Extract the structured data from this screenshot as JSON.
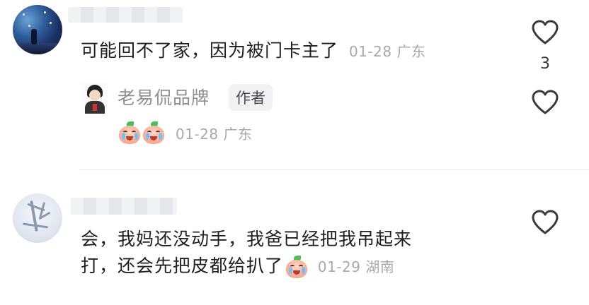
{
  "comments": [
    {
      "text": "可能回不了家，因为被门卡主了",
      "date": "01-28",
      "location": "广东",
      "like_count": "3",
      "reply": {
        "author": "老易侃品牌",
        "badge": "作者",
        "date": "01-28",
        "location": "广东",
        "emoji_count": 2,
        "emoji_name": "crying-peach-emoji"
      }
    },
    {
      "line1": "会，我妈还没动手，我爸已经把我吊起来",
      "line2": "打，还会先把皮都给扒了",
      "date": "01-29",
      "location": "湖南",
      "emoji_name": "crying-peach-emoji"
    }
  ],
  "icons": {
    "like": "heart-outline-icon"
  },
  "colors": {
    "text": "#1e1e1e",
    "meta": "#a9a9ad",
    "author": "#8f8f93",
    "badge_bg": "#f2f2f4",
    "heart_stroke": "#3a3a3e"
  }
}
